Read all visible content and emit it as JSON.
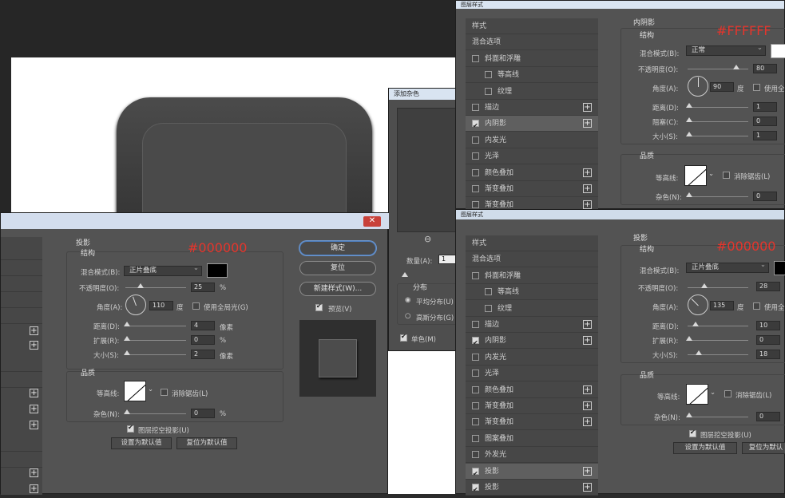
{
  "colors": {
    "annotation": "#e5352c",
    "black_swatch": "#000000",
    "white_swatch": "#FFFFFF"
  },
  "left_dialog": {
    "title": "",
    "section_title": "投影",
    "structure_label": "结构",
    "hex_annotation": "#000000",
    "blend_label": "混合模式(B):",
    "blend_value": "正片叠底",
    "opacity_label": "不透明度(O):",
    "opacity_value": "25",
    "opacity_unit": "%",
    "opacity_level": 25,
    "angle_label": "角度(A):",
    "angle_value": "110",
    "angle_unit": "度",
    "global_light_label": "使用全局光(G)",
    "distance_label": "距离(D):",
    "distance_value": "4",
    "distance_unit": "像素",
    "spread_label": "扩展(R):",
    "spread_value": "0",
    "spread_unit": "%",
    "size_label": "大小(S):",
    "size_value": "2",
    "size_unit": "像素",
    "quality_label": "品质",
    "contour_label": "等高线:",
    "antialias_label": "消除锯齿(L)",
    "noise_label": "杂色(N):",
    "noise_value": "0",
    "noise_unit": "%",
    "knockout_label": "图层挖空投影(U)",
    "set_default": "设置为默认值",
    "reset_default": "复位为默认值",
    "ok": "确定",
    "reset": "复位",
    "new_style": "新建样式(W)...",
    "preview": "预览(V)"
  },
  "noise_dialog": {
    "title": "添加杂色",
    "amount_label": "数量(A):",
    "amount_value": "1",
    "dist_label": "分布",
    "uniform": "平均分布(U)",
    "gaussian": "高斯分布(G)",
    "mono": "单色(M)"
  },
  "top_right_dialog": {
    "title": "图层样式",
    "section_title": "内阴影",
    "structure_label": "结构",
    "hex_annotation": "#FFFFFF",
    "blend_label": "混合模式(B):",
    "blend_value": "正常",
    "opacity_label": "不透明度(O):",
    "opacity_value": "80",
    "opacity_level": 80,
    "angle_label": "角度(A):",
    "angle_value": "90",
    "angle_unit": "度",
    "global_light_label": "使用全",
    "distance_label": "距离(D):",
    "distance_value": "1",
    "choke_label": "阻塞(C):",
    "choke_value": "0",
    "size_label": "大小(S):",
    "size_value": "1",
    "quality_label": "品质",
    "contour_label": "等高线:",
    "antialias_label": "消除锯齿(L)",
    "noise_label": "杂色(N):",
    "noise_value": "0",
    "list": [
      {
        "label": "样式",
        "cb": false,
        "hascb": false,
        "plus": false
      },
      {
        "label": "混合选项",
        "cb": false,
        "hascb": false,
        "plus": false
      },
      {
        "label": "斜面和浮雕",
        "cb": false,
        "hascb": true,
        "plus": false
      },
      {
        "label": "等高线",
        "cb": false,
        "hascb": true,
        "plus": false,
        "indent": true
      },
      {
        "label": "纹理",
        "cb": false,
        "hascb": true,
        "plus": false,
        "indent": true
      },
      {
        "label": "描边",
        "cb": false,
        "hascb": true,
        "plus": true
      },
      {
        "label": "内阴影",
        "cb": true,
        "hascb": true,
        "plus": true,
        "sel": true
      },
      {
        "label": "内发光",
        "cb": false,
        "hascb": true,
        "plus": false
      },
      {
        "label": "光泽",
        "cb": false,
        "hascb": true,
        "plus": false
      },
      {
        "label": "颜色叠加",
        "cb": false,
        "hascb": true,
        "plus": true
      },
      {
        "label": "渐变叠加",
        "cb": false,
        "hascb": true,
        "plus": true
      },
      {
        "label": "渐变叠加",
        "cb": false,
        "hascb": true,
        "plus": true
      }
    ]
  },
  "bottom_right_dialog": {
    "title": "图层样式",
    "section_title": "投影",
    "structure_label": "结构",
    "hex_annotation": "#000000",
    "blend_label": "混合模式(B):",
    "blend_value": "正片叠底",
    "opacity_label": "不透明度(O):",
    "opacity_value": "28",
    "opacity_level": 28,
    "angle_label": "角度(A):",
    "angle_value": "135",
    "angle_unit": "度",
    "global_light_label": "使用全",
    "distance_label": "距离(D):",
    "distance_value": "10",
    "spread_label": "扩展(R):",
    "spread_value": "0",
    "size_label": "大小(S):",
    "size_value": "18",
    "quality_label": "品质",
    "contour_label": "等高线:",
    "antialias_label": "消除锯齿(L)",
    "noise_label": "杂色(N):",
    "noise_value": "0",
    "knockout_label": "图层挖空投影(U)",
    "set_default": "设置为默认值",
    "reset_default": "复位为默认",
    "list": [
      {
        "label": "样式",
        "cb": false,
        "hascb": false,
        "plus": false
      },
      {
        "label": "混合选项",
        "cb": false,
        "hascb": false,
        "plus": false
      },
      {
        "label": "斜面和浮雕",
        "cb": false,
        "hascb": true,
        "plus": false
      },
      {
        "label": "等高线",
        "cb": false,
        "hascb": true,
        "plus": false,
        "indent": true
      },
      {
        "label": "纹理",
        "cb": false,
        "hascb": true,
        "plus": false,
        "indent": true
      },
      {
        "label": "描边",
        "cb": false,
        "hascb": true,
        "plus": true
      },
      {
        "label": "内阴影",
        "cb": true,
        "hascb": true,
        "plus": true
      },
      {
        "label": "内发光",
        "cb": false,
        "hascb": true,
        "plus": false
      },
      {
        "label": "光泽",
        "cb": false,
        "hascb": true,
        "plus": false
      },
      {
        "label": "颜色叠加",
        "cb": false,
        "hascb": true,
        "plus": true
      },
      {
        "label": "渐变叠加",
        "cb": false,
        "hascb": true,
        "plus": true
      },
      {
        "label": "渐变叠加",
        "cb": false,
        "hascb": true,
        "plus": true
      },
      {
        "label": "图案叠加",
        "cb": false,
        "hascb": true,
        "plus": false
      },
      {
        "label": "外发光",
        "cb": false,
        "hascb": true,
        "plus": false
      },
      {
        "label": "投影",
        "cb": true,
        "hascb": true,
        "plus": true,
        "sel": true
      },
      {
        "label": "投影",
        "cb": true,
        "hascb": true,
        "plus": true
      }
    ]
  }
}
